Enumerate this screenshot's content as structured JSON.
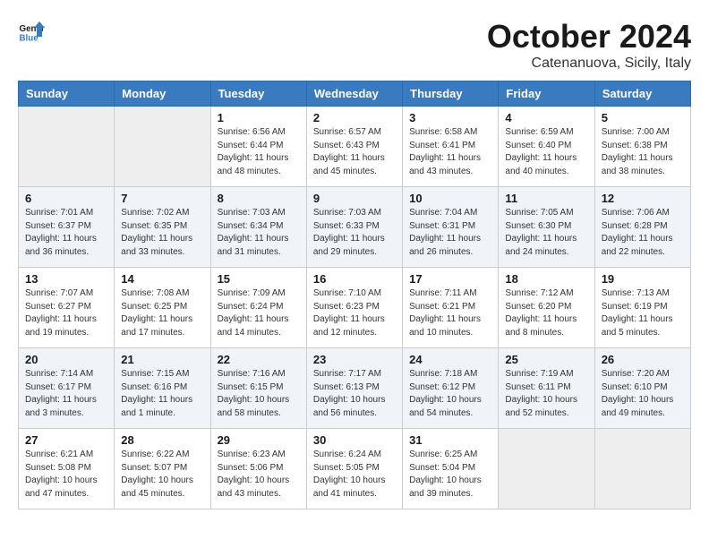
{
  "header": {
    "logo_line1": "General",
    "logo_line2": "Blue",
    "month": "October 2024",
    "location": "Catenanuova, Sicily, Italy"
  },
  "weekdays": [
    "Sunday",
    "Monday",
    "Tuesday",
    "Wednesday",
    "Thursday",
    "Friday",
    "Saturday"
  ],
  "weeks": [
    [
      {
        "day": "",
        "empty": true
      },
      {
        "day": "",
        "empty": true
      },
      {
        "day": "1",
        "sunrise": "Sunrise: 6:56 AM",
        "sunset": "Sunset: 6:44 PM",
        "daylight": "Daylight: 11 hours and 48 minutes."
      },
      {
        "day": "2",
        "sunrise": "Sunrise: 6:57 AM",
        "sunset": "Sunset: 6:43 PM",
        "daylight": "Daylight: 11 hours and 45 minutes."
      },
      {
        "day": "3",
        "sunrise": "Sunrise: 6:58 AM",
        "sunset": "Sunset: 6:41 PM",
        "daylight": "Daylight: 11 hours and 43 minutes."
      },
      {
        "day": "4",
        "sunrise": "Sunrise: 6:59 AM",
        "sunset": "Sunset: 6:40 PM",
        "daylight": "Daylight: 11 hours and 40 minutes."
      },
      {
        "day": "5",
        "sunrise": "Sunrise: 7:00 AM",
        "sunset": "Sunset: 6:38 PM",
        "daylight": "Daylight: 11 hours and 38 minutes."
      }
    ],
    [
      {
        "day": "6",
        "sunrise": "Sunrise: 7:01 AM",
        "sunset": "Sunset: 6:37 PM",
        "daylight": "Daylight: 11 hours and 36 minutes."
      },
      {
        "day": "7",
        "sunrise": "Sunrise: 7:02 AM",
        "sunset": "Sunset: 6:35 PM",
        "daylight": "Daylight: 11 hours and 33 minutes."
      },
      {
        "day": "8",
        "sunrise": "Sunrise: 7:03 AM",
        "sunset": "Sunset: 6:34 PM",
        "daylight": "Daylight: 11 hours and 31 minutes."
      },
      {
        "day": "9",
        "sunrise": "Sunrise: 7:03 AM",
        "sunset": "Sunset: 6:33 PM",
        "daylight": "Daylight: 11 hours and 29 minutes."
      },
      {
        "day": "10",
        "sunrise": "Sunrise: 7:04 AM",
        "sunset": "Sunset: 6:31 PM",
        "daylight": "Daylight: 11 hours and 26 minutes."
      },
      {
        "day": "11",
        "sunrise": "Sunrise: 7:05 AM",
        "sunset": "Sunset: 6:30 PM",
        "daylight": "Daylight: 11 hours and 24 minutes."
      },
      {
        "day": "12",
        "sunrise": "Sunrise: 7:06 AM",
        "sunset": "Sunset: 6:28 PM",
        "daylight": "Daylight: 11 hours and 22 minutes."
      }
    ],
    [
      {
        "day": "13",
        "sunrise": "Sunrise: 7:07 AM",
        "sunset": "Sunset: 6:27 PM",
        "daylight": "Daylight: 11 hours and 19 minutes."
      },
      {
        "day": "14",
        "sunrise": "Sunrise: 7:08 AM",
        "sunset": "Sunset: 6:25 PM",
        "daylight": "Daylight: 11 hours and 17 minutes."
      },
      {
        "day": "15",
        "sunrise": "Sunrise: 7:09 AM",
        "sunset": "Sunset: 6:24 PM",
        "daylight": "Daylight: 11 hours and 14 minutes."
      },
      {
        "day": "16",
        "sunrise": "Sunrise: 7:10 AM",
        "sunset": "Sunset: 6:23 PM",
        "daylight": "Daylight: 11 hours and 12 minutes."
      },
      {
        "day": "17",
        "sunrise": "Sunrise: 7:11 AM",
        "sunset": "Sunset: 6:21 PM",
        "daylight": "Daylight: 11 hours and 10 minutes."
      },
      {
        "day": "18",
        "sunrise": "Sunrise: 7:12 AM",
        "sunset": "Sunset: 6:20 PM",
        "daylight": "Daylight: 11 hours and 8 minutes."
      },
      {
        "day": "19",
        "sunrise": "Sunrise: 7:13 AM",
        "sunset": "Sunset: 6:19 PM",
        "daylight": "Daylight: 11 hours and 5 minutes."
      }
    ],
    [
      {
        "day": "20",
        "sunrise": "Sunrise: 7:14 AM",
        "sunset": "Sunset: 6:17 PM",
        "daylight": "Daylight: 11 hours and 3 minutes."
      },
      {
        "day": "21",
        "sunrise": "Sunrise: 7:15 AM",
        "sunset": "Sunset: 6:16 PM",
        "daylight": "Daylight: 11 hours and 1 minute."
      },
      {
        "day": "22",
        "sunrise": "Sunrise: 7:16 AM",
        "sunset": "Sunset: 6:15 PM",
        "daylight": "Daylight: 10 hours and 58 minutes."
      },
      {
        "day": "23",
        "sunrise": "Sunrise: 7:17 AM",
        "sunset": "Sunset: 6:13 PM",
        "daylight": "Daylight: 10 hours and 56 minutes."
      },
      {
        "day": "24",
        "sunrise": "Sunrise: 7:18 AM",
        "sunset": "Sunset: 6:12 PM",
        "daylight": "Daylight: 10 hours and 54 minutes."
      },
      {
        "day": "25",
        "sunrise": "Sunrise: 7:19 AM",
        "sunset": "Sunset: 6:11 PM",
        "daylight": "Daylight: 10 hours and 52 minutes."
      },
      {
        "day": "26",
        "sunrise": "Sunrise: 7:20 AM",
        "sunset": "Sunset: 6:10 PM",
        "daylight": "Daylight: 10 hours and 49 minutes."
      }
    ],
    [
      {
        "day": "27",
        "sunrise": "Sunrise: 6:21 AM",
        "sunset": "Sunset: 5:08 PM",
        "daylight": "Daylight: 10 hours and 47 minutes."
      },
      {
        "day": "28",
        "sunrise": "Sunrise: 6:22 AM",
        "sunset": "Sunset: 5:07 PM",
        "daylight": "Daylight: 10 hours and 45 minutes."
      },
      {
        "day": "29",
        "sunrise": "Sunrise: 6:23 AM",
        "sunset": "Sunset: 5:06 PM",
        "daylight": "Daylight: 10 hours and 43 minutes."
      },
      {
        "day": "30",
        "sunrise": "Sunrise: 6:24 AM",
        "sunset": "Sunset: 5:05 PM",
        "daylight": "Daylight: 10 hours and 41 minutes."
      },
      {
        "day": "31",
        "sunrise": "Sunrise: 6:25 AM",
        "sunset": "Sunset: 5:04 PM",
        "daylight": "Daylight: 10 hours and 39 minutes."
      },
      {
        "day": "",
        "empty": true
      },
      {
        "day": "",
        "empty": true
      }
    ]
  ]
}
